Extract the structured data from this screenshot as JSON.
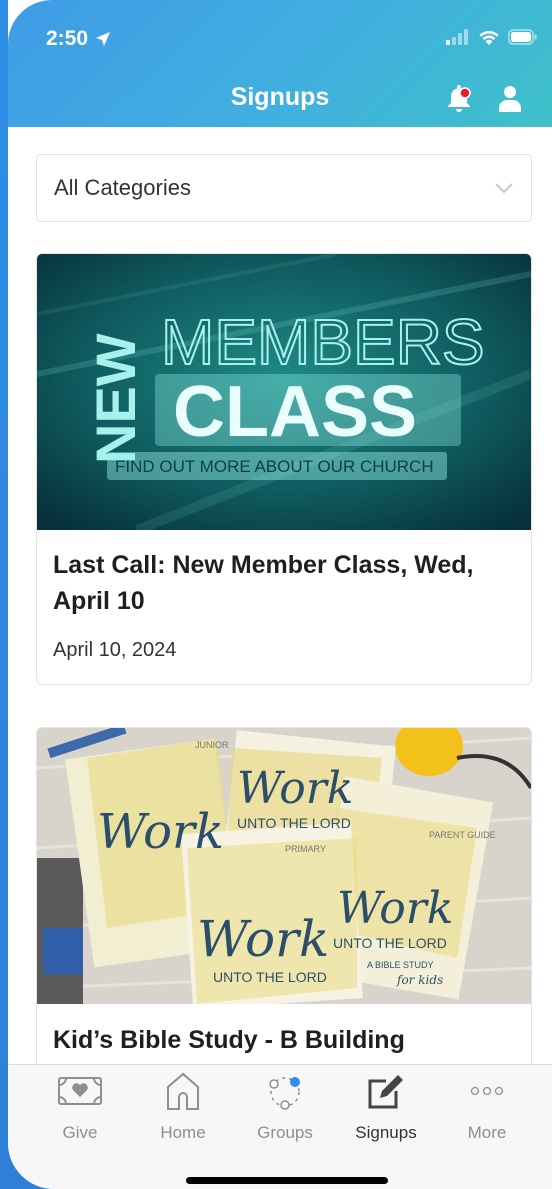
{
  "status_bar": {
    "time": "2:50"
  },
  "header": {
    "title": "Signups"
  },
  "filter": {
    "selected": "All Categories"
  },
  "cards": [
    {
      "image_text": {
        "new": "NEW",
        "members": "MEMBERS",
        "class": "CLASS",
        "tagline": "FIND OUT MORE ABOUT OUR CHURCH"
      },
      "title": "Last Call: New Member Class, Wed, April 10",
      "date": "April 10, 2024"
    },
    {
      "image_text": {
        "book_title": "Work",
        "subtitle": "UNTO THE LORD",
        "junior": "JUNIOR",
        "primary": "PRIMARY",
        "parent_guide": "PARENT GUIDE",
        "bible_study": "A BIBLE STUDY",
        "for_kids": "for kids"
      },
      "title": "Kid’s Bible Study - B Building"
    }
  ],
  "tabs": [
    {
      "label": "Give",
      "icon": "give-icon"
    },
    {
      "label": "Home",
      "icon": "home-icon"
    },
    {
      "label": "Groups",
      "icon": "groups-icon"
    },
    {
      "label": "Signups",
      "icon": "signups-icon",
      "active": true
    },
    {
      "label": "More",
      "icon": "more-icon"
    }
  ],
  "colors": {
    "header_start": "#3f9be6",
    "header_end": "#3fc0c8",
    "notification_dot": "#e0202a",
    "groups_dot": "#2f8fe6"
  }
}
